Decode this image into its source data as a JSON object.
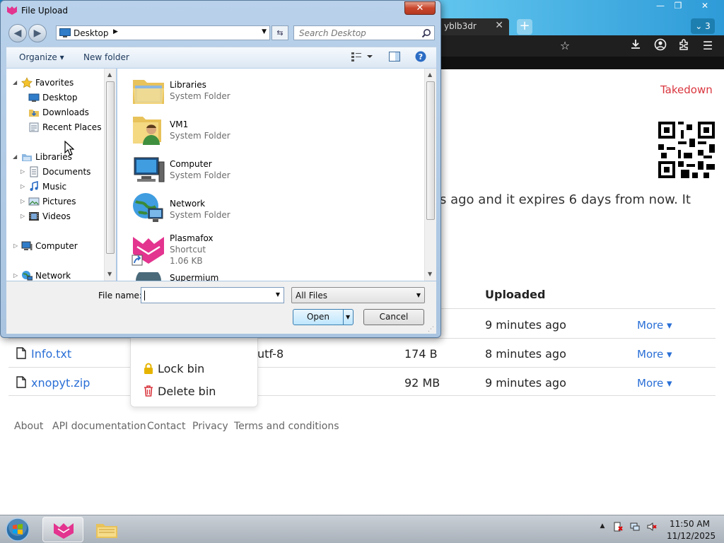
{
  "browser": {
    "tab_title": "yblb3dr",
    "tab_close": "✕",
    "new_tab": "+",
    "tab_count": "3",
    "win_min": "—",
    "win_max": "❐",
    "win_close": "✕",
    "icons": [
      "star-icon",
      "download-icon",
      "account-icon",
      "extensions-icon",
      "menu-icon"
    ]
  },
  "page": {
    "takedown": "Takedown",
    "description": "s ago and it expires 6 days from now. It",
    "table": {
      "uploaded_header": "Uploaded",
      "rows": [
        {
          "name": "",
          "encoding": "",
          "size": "",
          "uploaded": "9 minutes ago",
          "more": "More"
        },
        {
          "name": "Info.txt",
          "encoding": "utf-8",
          "size": "174 B",
          "uploaded": "8 minutes ago",
          "more": "More"
        },
        {
          "name": "xnopyt.zip",
          "encoding": "",
          "size": "92 MB",
          "uploaded": "9 minutes ago",
          "more": "More"
        }
      ]
    },
    "context_menu": {
      "lock": "Lock bin",
      "delete": "Delete bin"
    },
    "footer": [
      "About",
      "API documentation",
      "Contact",
      "Privacy",
      "Terms and conditions"
    ]
  },
  "dialog": {
    "title": "File Upload",
    "close_glyph": "✕",
    "back_glyph": "◀",
    "forward_glyph": "▶",
    "address": "Desktop",
    "search_placeholder": "Search Desktop",
    "toolbar": {
      "organize": "Organize ▾",
      "new_folder": "New folder"
    },
    "nav_tree": {
      "favorites": "Favorites",
      "desktop": "Desktop",
      "downloads": "Downloads",
      "recent": "Recent Places",
      "libraries": "Libraries",
      "documents": "Documents",
      "music": "Music",
      "pictures": "Pictures",
      "videos": "Videos",
      "computer": "Computer",
      "network": "Network"
    },
    "files": [
      {
        "name": "Libraries",
        "type": "System Folder",
        "size": ""
      },
      {
        "name": "VM1",
        "type": "System Folder",
        "size": ""
      },
      {
        "name": "Computer",
        "type": "System Folder",
        "size": ""
      },
      {
        "name": "Network",
        "type": "System Folder",
        "size": ""
      },
      {
        "name": "Plasmafox",
        "type": "Shortcut",
        "size": "1.06 KB"
      },
      {
        "name": "Supermium",
        "type": "",
        "size": ""
      }
    ],
    "file_name_label": "File name:",
    "file_name_value": "",
    "filter": "All Files",
    "open": "Open",
    "cancel": "Cancel"
  },
  "taskbar": {
    "time": "11:50 AM",
    "date": "11/12/2025",
    "tray_arrow": "▲"
  },
  "colors": {
    "accent_link": "#2a6fd6",
    "takedown_red": "#d9363e",
    "dialog_frame": "#b9d1ea"
  }
}
